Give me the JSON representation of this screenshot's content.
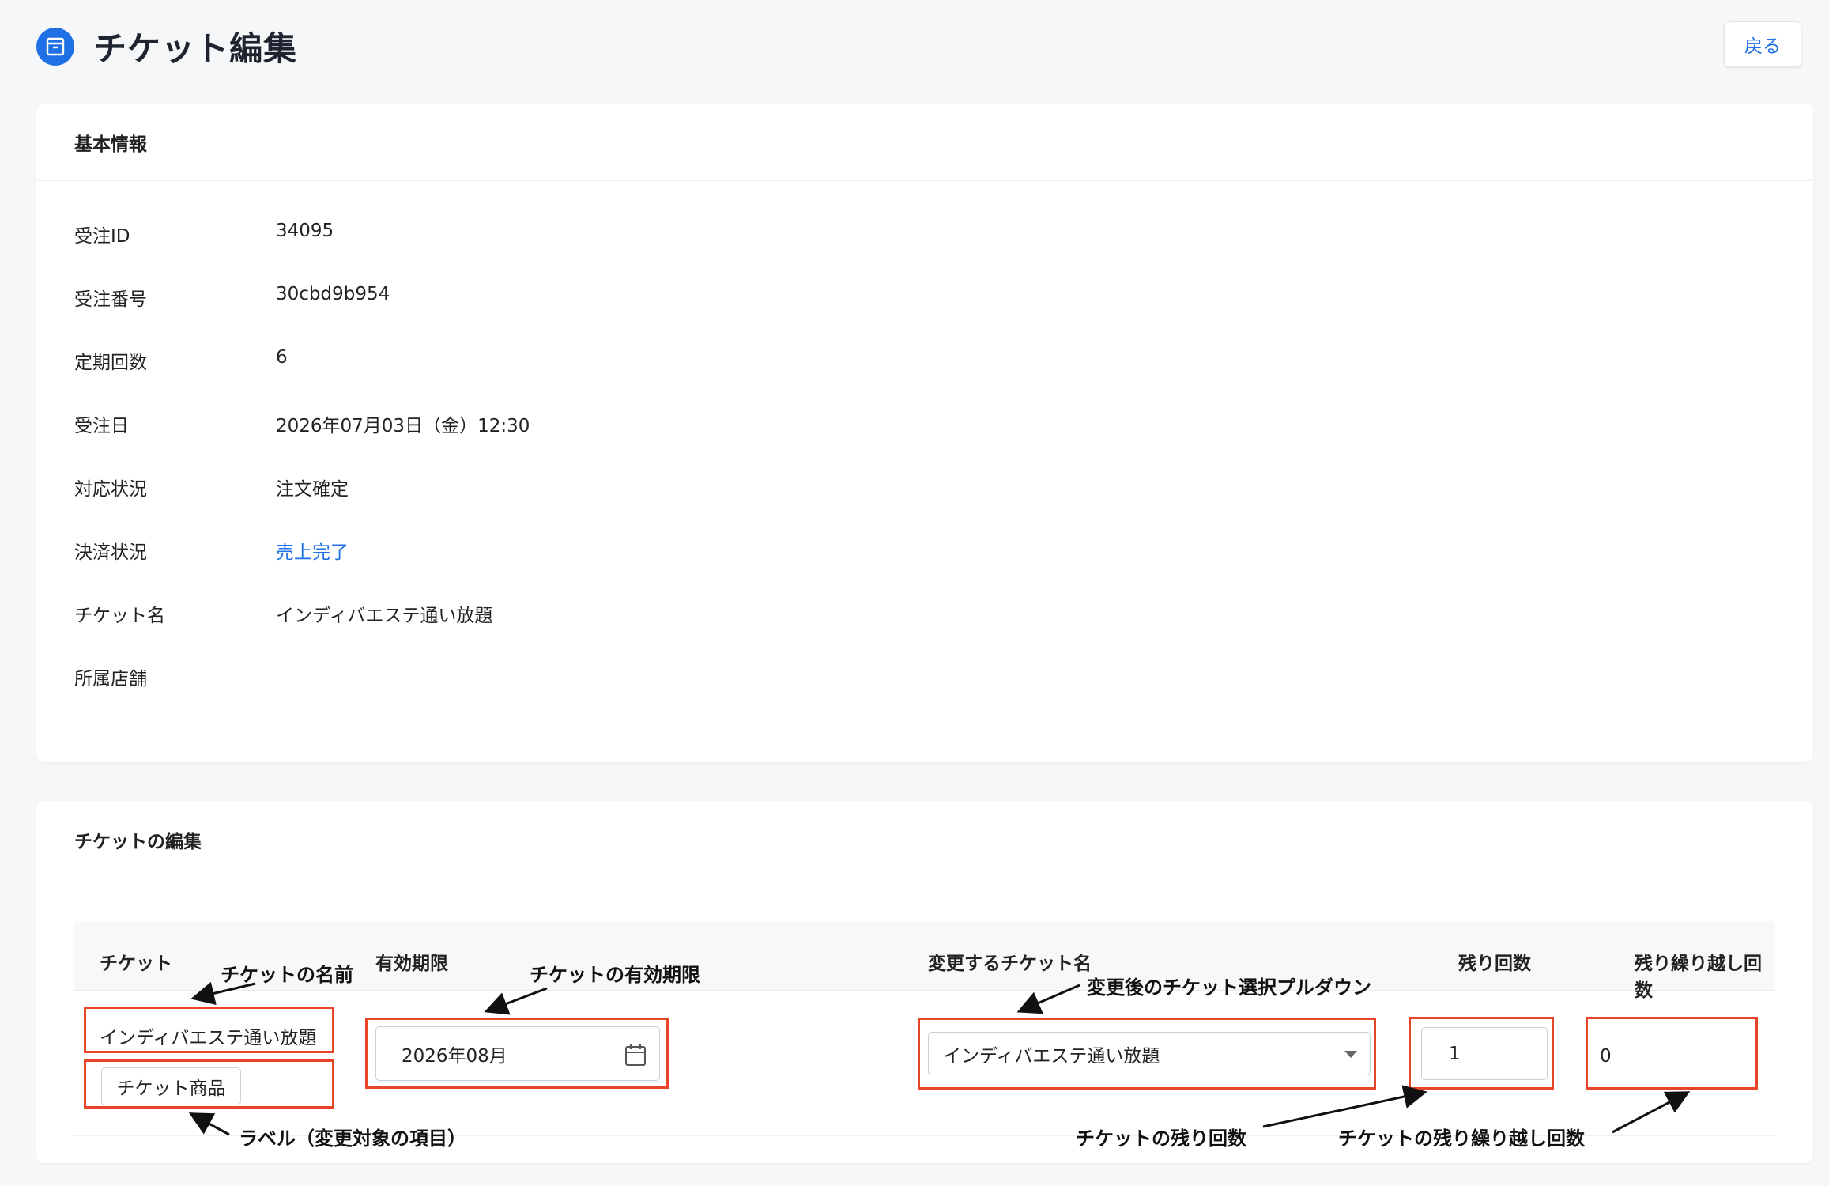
{
  "header": {
    "title": "チケット編集",
    "back_label": "戻る"
  },
  "basic_info": {
    "heading": "基本情報",
    "rows": [
      {
        "label": "受注ID",
        "value": "34095"
      },
      {
        "label": "受注番号",
        "value": "30cbd9b954"
      },
      {
        "label": "定期回数",
        "value": "6"
      },
      {
        "label": "受注日",
        "value": "2026年07月03日（金）12:30"
      },
      {
        "label": "対応状況",
        "value": "注文確定"
      },
      {
        "label": "決済状況",
        "value": "売上完了"
      },
      {
        "label": "チケット名",
        "value": "インディバエステ通い放題"
      },
      {
        "label": "所属店舗",
        "value": ""
      }
    ]
  },
  "ticket_edit": {
    "heading": "チケットの編集",
    "columns": {
      "ticket": "チケット",
      "expiry": "有効期限",
      "new_ticket_name": "変更するチケット名",
      "remaining": "残り回数",
      "remaining_carryover": "残り繰り越し回数"
    },
    "row": {
      "ticket_name": "インディバエステ通い放題",
      "tag": "チケット商品",
      "expiry_value": "2026年08月",
      "selected_ticket": "インディバエステ通い放題",
      "remaining_value": "1",
      "carryover_value": "0"
    }
  },
  "annotations": {
    "ticket_name": "チケットの名前",
    "expiry": "チケットの有効期限",
    "select": "変更後のチケット選択プルダウン",
    "label": "ラベル（変更対象の項目）",
    "remaining": "チケットの残り回数",
    "carryover": "チケットの残り繰り越し回数"
  },
  "colors": {
    "accent": "#1f6fe5",
    "highlight": "#e8442a"
  }
}
